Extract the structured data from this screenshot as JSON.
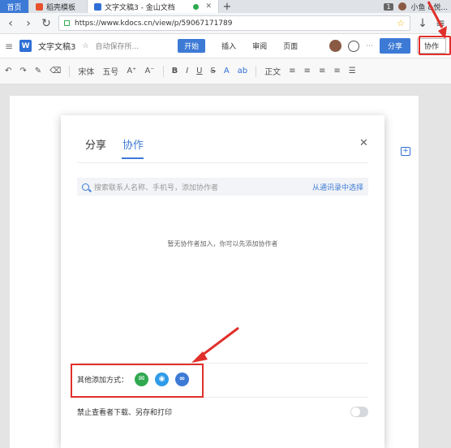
{
  "browser": {
    "tabs": [
      {
        "label": "首页"
      },
      {
        "label": "稻壳模板"
      },
      {
        "label": "文字文稿3 - 金山文档"
      }
    ],
    "tab_count": "1",
    "user_name": "小鱼 &悦...",
    "url": "https://www.kdocs.cn/view/p/59067171789"
  },
  "app": {
    "doc_title": "文字文稿3",
    "autosave_status": "自动保存所...",
    "menus": [
      "开始",
      "插入",
      "审阅",
      "页面"
    ],
    "share_label": "分享",
    "collab_label": "协作"
  },
  "toolbar": {
    "font_name": "宋体",
    "font_size": "五号",
    "style": "正文"
  },
  "modal": {
    "tabs": [
      "分享",
      "协作"
    ],
    "active_tab": "协作",
    "search_placeholder": "搜索联系人名称、手机号，添加协作者",
    "contacts_link": "从通讯录中选择",
    "empty_text": "暂无协作者加入，你可以先添加协作者",
    "other_methods_label": "其他添加方式：",
    "other_methods": [
      "wechat-icon",
      "qq-icon",
      "link-icon"
    ],
    "permission_label": "禁止查看者下载、另存和打印",
    "permission_toggle_on": false
  },
  "colors": {
    "accent": "#3d7ad6",
    "annotation": "#e0302b"
  }
}
